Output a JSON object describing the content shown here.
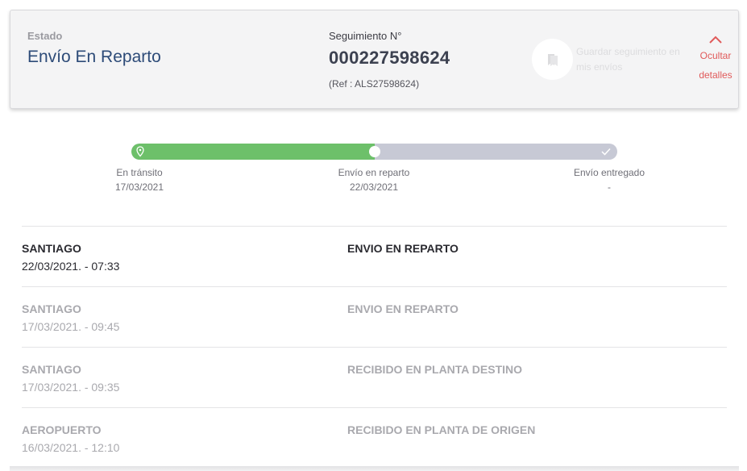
{
  "status": {
    "label": "Estado",
    "value": "Envío En Reparto"
  },
  "tracking": {
    "label": "Seguimiento N°",
    "number": "000227598624",
    "ref": "(Ref : ALS27598624)"
  },
  "save": {
    "label": "Guardar seguimiento en mis envíos",
    "icon": "bookmark-icon"
  },
  "toggle": {
    "label": "Ocultar detalles",
    "icon": "chevron-up-icon",
    "color": "#e05a5a"
  },
  "progress": {
    "filled_fraction": 0.5,
    "colors": {
      "filled": "#6dc06a",
      "empty": "#c7c9d5"
    },
    "steps": [
      {
        "label": "En tránsito",
        "date": "17/03/2021",
        "icon": "location-pin-icon"
      },
      {
        "label": "Envío en reparto",
        "date": "22/03/2021"
      },
      {
        "label": "Envío entregado",
        "date": "-",
        "icon": "check-icon"
      }
    ]
  },
  "history": [
    {
      "place": "SANTIAGO",
      "datetime": "22/03/2021. - 07:33",
      "event": "ENVIO EN REPARTO",
      "active": true
    },
    {
      "place": "SANTIAGO",
      "datetime": "17/03/2021. - 09:45",
      "event": "ENVIO EN REPARTO",
      "active": false
    },
    {
      "place": "SANTIAGO",
      "datetime": "17/03/2021. - 09:35",
      "event": "RECIBIDO EN PLANTA DESTINO",
      "active": false
    },
    {
      "place": "AEROPUERTO",
      "datetime": "16/03/2021. - 12:10",
      "event": "RECIBIDO EN PLANTA DE ORIGEN",
      "active": false
    }
  ]
}
